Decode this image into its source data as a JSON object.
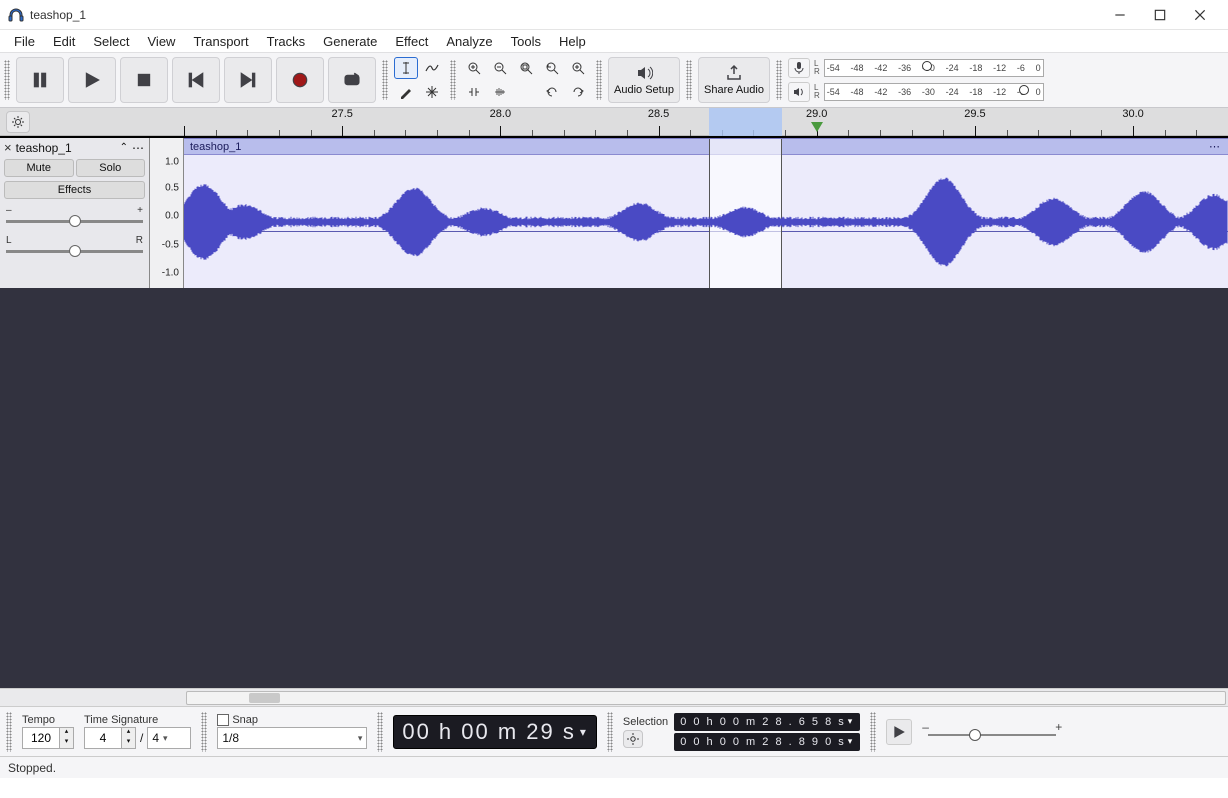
{
  "window": {
    "title": "teashop_1"
  },
  "menu": [
    "File",
    "Edit",
    "Select",
    "View",
    "Transport",
    "Tracks",
    "Generate",
    "Effect",
    "Analyze",
    "Tools",
    "Help"
  ],
  "toolbar": {
    "audio_setup": "Audio Setup",
    "share_audio": "Share Audio"
  },
  "meters": {
    "db_ticks": [
      "-54",
      "-48",
      "-42",
      "-36",
      "-30",
      "-24",
      "-18",
      "-12",
      "-6",
      "0"
    ],
    "rec_marker_db": -30,
    "play_marker_db": -6
  },
  "timeline": {
    "start": 27.0,
    "end": 30.3,
    "major_interval": 0.5,
    "labels": [
      "27.5",
      "28.0",
      "28.5",
      "29.0",
      "29.5",
      "30.0"
    ],
    "selection_start": 28.658,
    "selection_end": 28.89,
    "playhead": 29.0
  },
  "track": {
    "name": "teashop_1",
    "clip_name": "teashop_1",
    "mute": "Mute",
    "solo": "Solo",
    "effects": "Effects",
    "gain_left": "–",
    "gain_right": "+",
    "pan_left": "L",
    "pan_right": "R",
    "vscale": [
      "1.0",
      "0.5",
      "0.0",
      "-0.5",
      "-1.0"
    ]
  },
  "bottom": {
    "tempo_label": "Tempo",
    "tempo_value": "120",
    "timesig_label": "Time Signature",
    "timesig_num": "4",
    "timesig_den": "4",
    "snap_label": "Snap",
    "snap_value": "1/8",
    "time_display": "00 h 00 m 29 s",
    "selection_label": "Selection",
    "selection_start": "0 0 h 0 0 m 2 8 . 6 5 8 s",
    "selection_end": "0 0 h 0 0 m 2 8 . 8 9 0 s",
    "speed_minus": "–",
    "speed_plus": "+"
  },
  "status": {
    "text": "Stopped."
  }
}
